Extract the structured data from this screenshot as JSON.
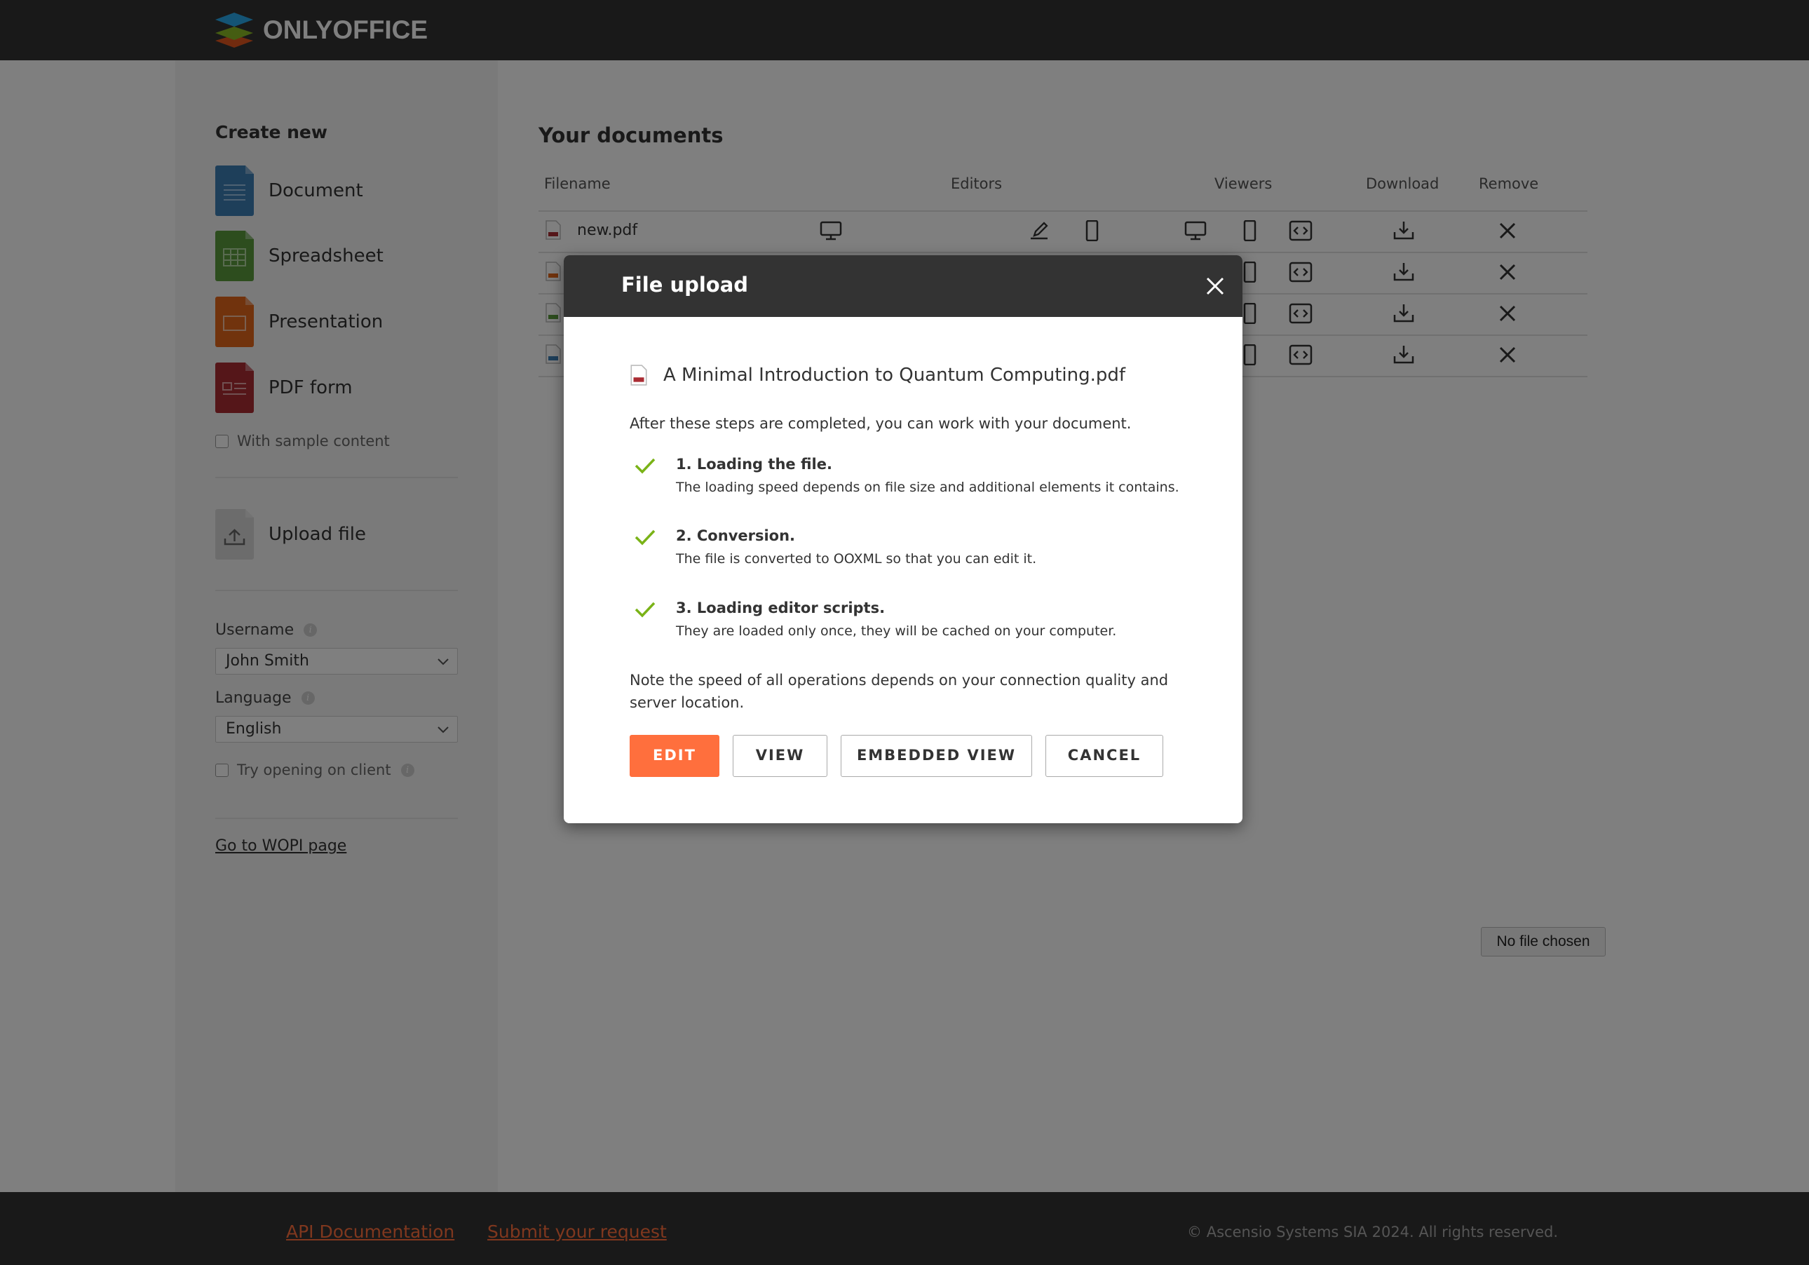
{
  "header": {
    "logo_text": "ONLYOFFICE"
  },
  "sidebar": {
    "create_title": "Create new",
    "create_items": [
      {
        "label": "Document",
        "color": "#3d7eb4"
      },
      {
        "label": "Spreadsheet",
        "color": "#5a9a3d"
      },
      {
        "label": "Presentation",
        "color": "#e2661b"
      },
      {
        "label": "PDF form",
        "color": "#aa2c33"
      }
    ],
    "sample_content_label": "With sample content",
    "upload_label": "Upload file",
    "username_label": "Username",
    "username_value": "John Smith",
    "language_label": "Language",
    "language_value": "English",
    "try_client_label": "Try opening on client",
    "wopi_link": "Go to WOPI page"
  },
  "documents": {
    "title": "Your documents",
    "columns": {
      "filename": "Filename",
      "editors": "Editors",
      "viewers": "Viewers",
      "download": "Download",
      "remove": "Remove"
    },
    "files": [
      {
        "name": "new.pdf",
        "type": "pdf"
      },
      {
        "name": "",
        "type": "presentation"
      },
      {
        "name": "",
        "type": "spreadsheet"
      },
      {
        "name": "",
        "type": "document"
      }
    ],
    "file_input": "No file chosen"
  },
  "footer": {
    "api_docs": "API Documentation",
    "submit_request": "Submit your request",
    "copyright": "© Ascensio Systems SIA 2024. All rights reserved."
  },
  "modal": {
    "title": "File upload",
    "file_name": "A Minimal Introduction to Quantum Computing.pdf",
    "intro": "After these steps are completed, you can work with your document.",
    "steps": [
      {
        "title": "1. Loading the file.",
        "desc": "The loading speed depends on file size and additional elements it contains."
      },
      {
        "title": "2. Conversion.",
        "desc": "The file is converted to OOXML so that you can edit it."
      },
      {
        "title": "3. Loading editor scripts.",
        "desc": "They are loaded only once, they will be cached on your computer."
      }
    ],
    "note": "Note the speed of all operations depends on your connection quality and server location.",
    "buttons": {
      "edit": "EDIT",
      "view": "VIEW",
      "embedded": "EMBEDDED VIEW",
      "cancel": "CANCEL"
    }
  },
  "colors": {
    "accent": "#ff6f3d",
    "header_bg": "#333333",
    "check": "#7ab317"
  }
}
